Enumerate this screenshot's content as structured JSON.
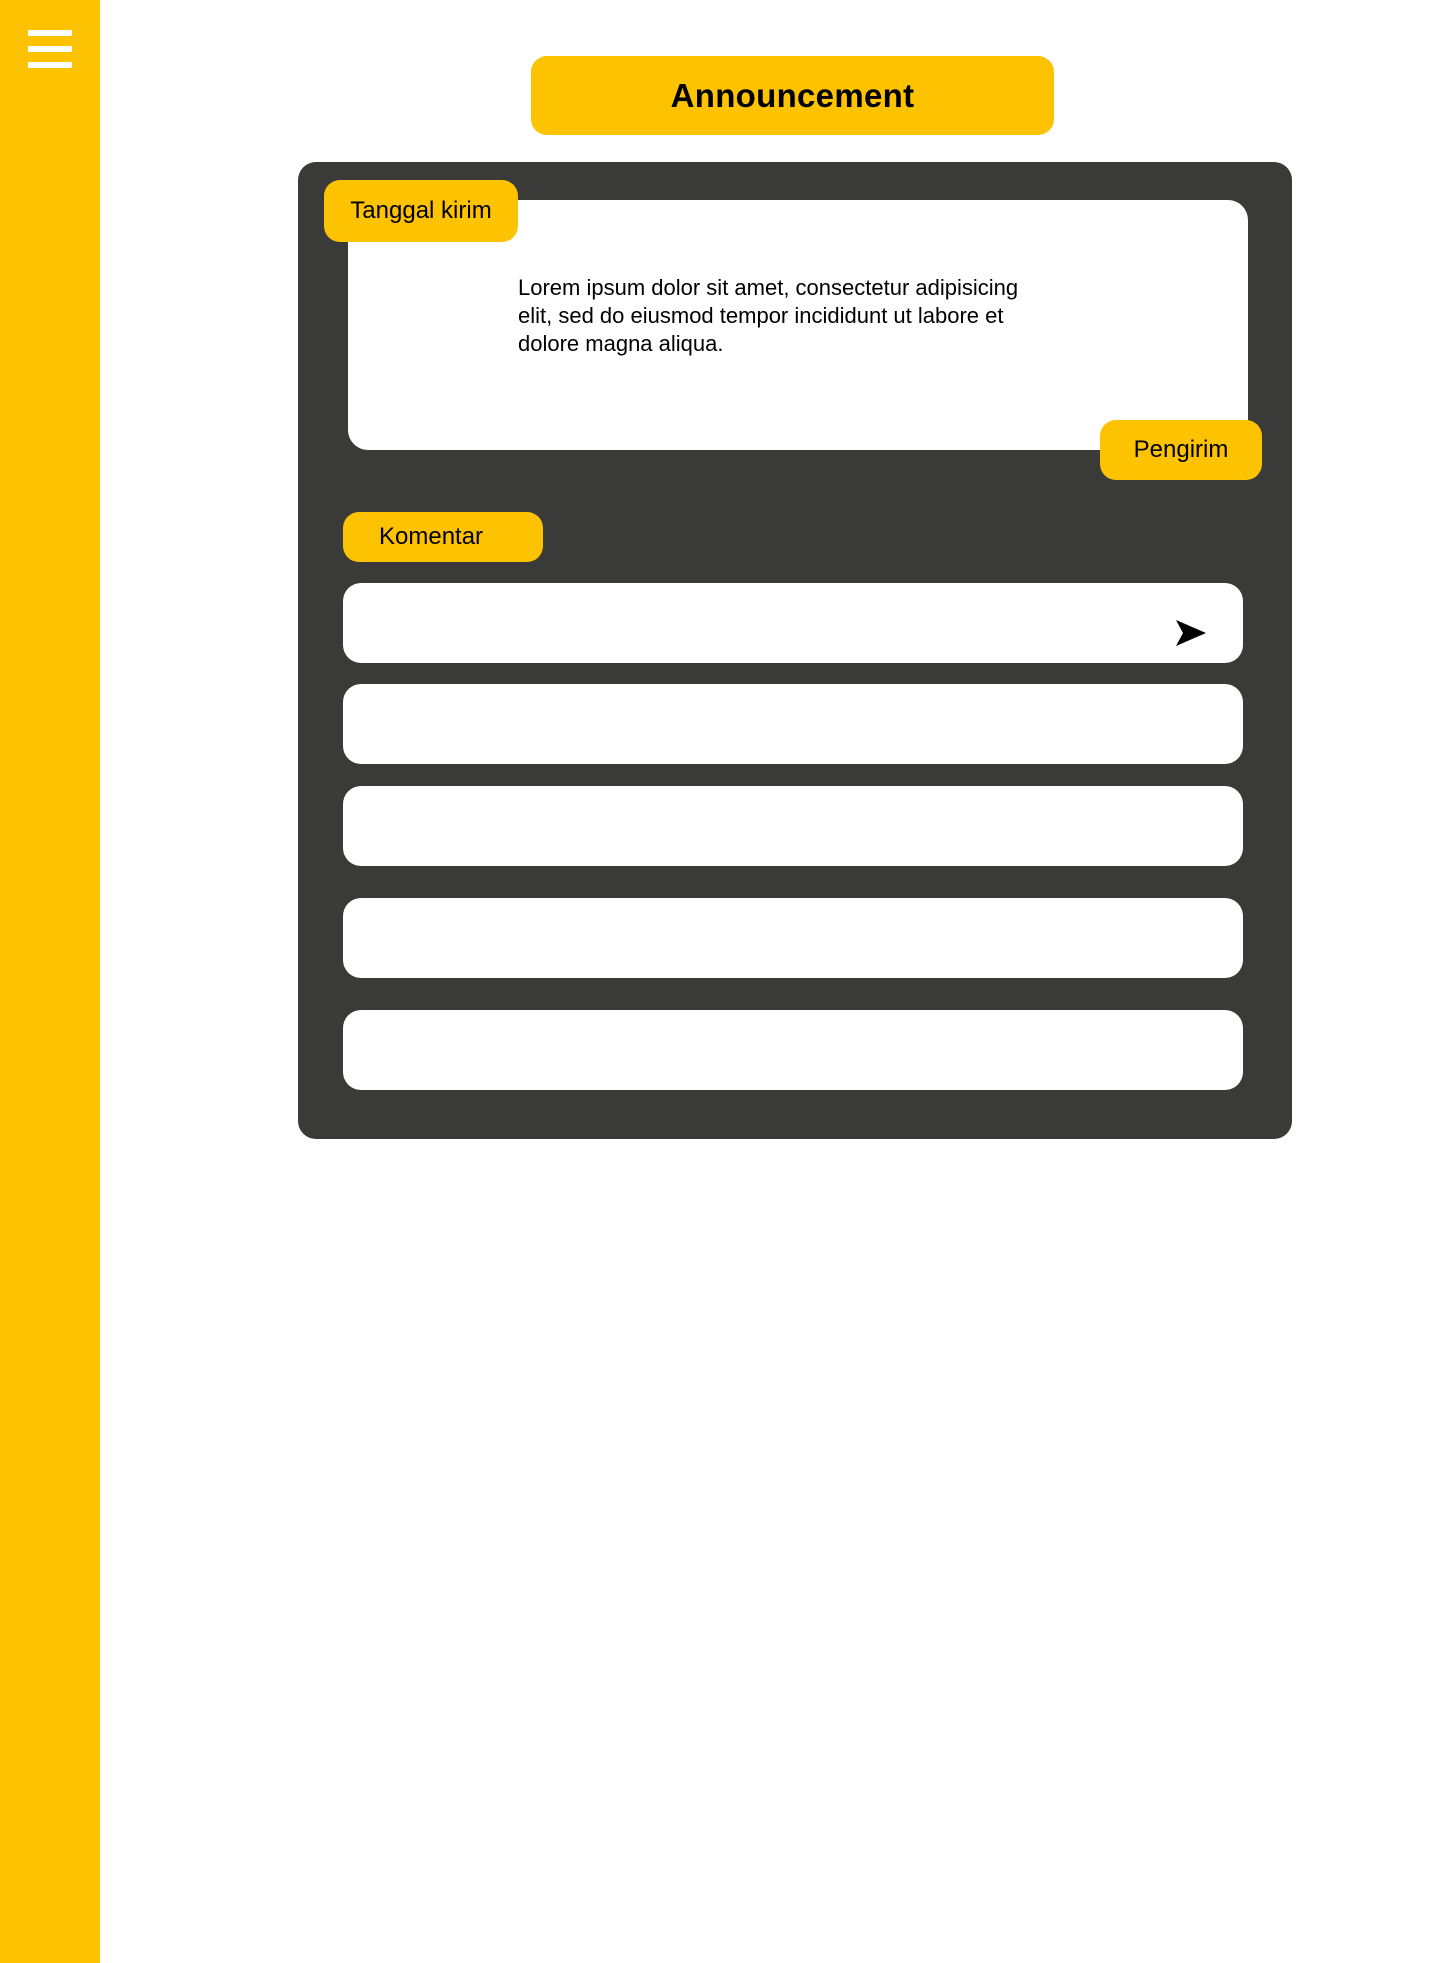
{
  "sidebar": {
    "menu_icon": "hamburger-menu-icon",
    "background_color": "#FDC300"
  },
  "header": {
    "title": "Announcement"
  },
  "announcement": {
    "date_label": "Tanggal kirim",
    "message": "Lorem ipsum dolor sit amet, consectetur adipisicing elit, sed do eiusmod tempor incididunt ut labore et dolore magna aliqua.",
    "sender_label": "Pengirim"
  },
  "comments": {
    "label": "Komentar",
    "input": {
      "value": "",
      "send_icon": "send-icon"
    },
    "items": [
      "",
      "",
      "",
      ""
    ]
  },
  "colors": {
    "accent": "#FDC300",
    "panel": "#3A3A39",
    "card": "#FFFFFF"
  }
}
